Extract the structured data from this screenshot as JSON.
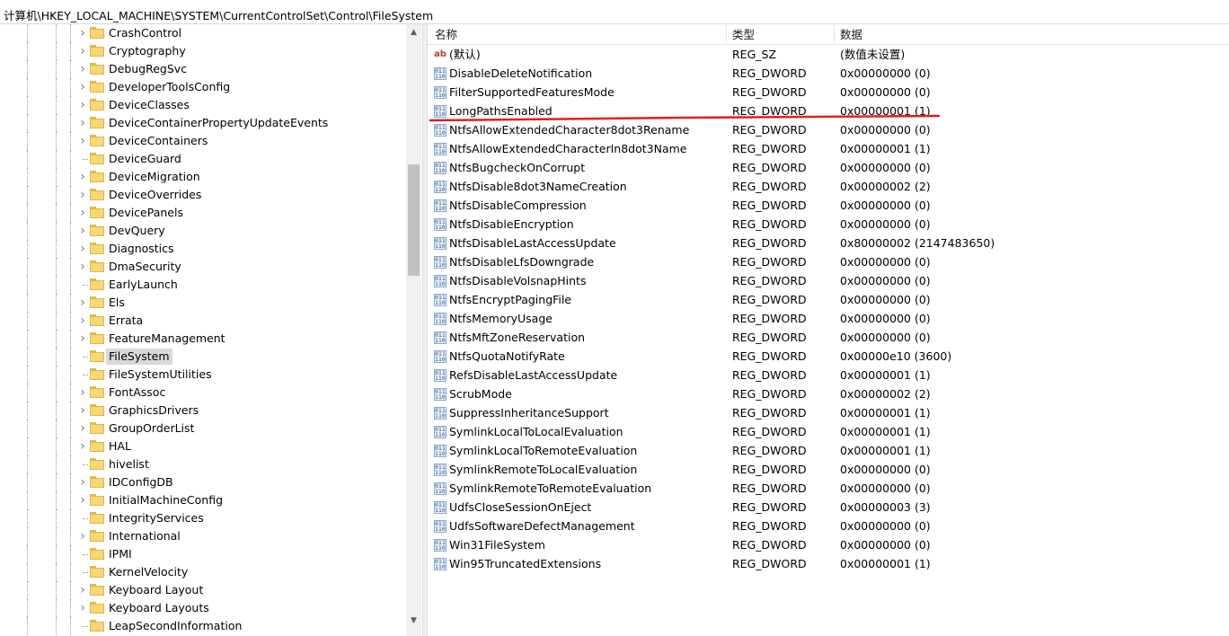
{
  "address_bar": {
    "path": "计算机\\HKEY_LOCAL_MACHINE\\SYSTEM\\CurrentControlSet\\Control\\FileSystem"
  },
  "tree": {
    "items": [
      {
        "label": "CrashControl",
        "expandable": true
      },
      {
        "label": "Cryptography",
        "expandable": true
      },
      {
        "label": "DebugRegSvc",
        "expandable": true
      },
      {
        "label": "DeveloperToolsConfig",
        "expandable": true
      },
      {
        "label": "DeviceClasses",
        "expandable": true
      },
      {
        "label": "DeviceContainerPropertyUpdateEvents",
        "expandable": true
      },
      {
        "label": "DeviceContainers",
        "expandable": true
      },
      {
        "label": "DeviceGuard",
        "expandable": false
      },
      {
        "label": "DeviceMigration",
        "expandable": true
      },
      {
        "label": "DeviceOverrides",
        "expandable": true
      },
      {
        "label": "DevicePanels",
        "expandable": true
      },
      {
        "label": "DevQuery",
        "expandable": true
      },
      {
        "label": "Diagnostics",
        "expandable": true
      },
      {
        "label": "DmaSecurity",
        "expandable": true
      },
      {
        "label": "EarlyLaunch",
        "expandable": false
      },
      {
        "label": "Els",
        "expandable": true
      },
      {
        "label": "Errata",
        "expandable": true
      },
      {
        "label": "FeatureManagement",
        "expandable": true
      },
      {
        "label": "FileSystem",
        "expandable": false,
        "selected": true
      },
      {
        "label": "FileSystemUtilities",
        "expandable": false
      },
      {
        "label": "FontAssoc",
        "expandable": true
      },
      {
        "label": "GraphicsDrivers",
        "expandable": true
      },
      {
        "label": "GroupOrderList",
        "expandable": true
      },
      {
        "label": "HAL",
        "expandable": true
      },
      {
        "label": "hivelist",
        "expandable": false
      },
      {
        "label": "IDConfigDB",
        "expandable": true
      },
      {
        "label": "InitialMachineConfig",
        "expandable": true
      },
      {
        "label": "IntegrityServices",
        "expandable": false
      },
      {
        "label": "International",
        "expandable": true
      },
      {
        "label": "IPMI",
        "expandable": false
      },
      {
        "label": "KernelVelocity",
        "expandable": false
      },
      {
        "label": "Keyboard Layout",
        "expandable": true
      },
      {
        "label": "Keyboard Layouts",
        "expandable": true
      },
      {
        "label": "LeapSecondInformation",
        "expandable": false
      }
    ]
  },
  "values_list": {
    "headers": {
      "name": "名称",
      "type": "类型",
      "data": "数据"
    },
    "rows": [
      {
        "icon": "ab",
        "name": "(默认)",
        "type": "REG_SZ",
        "data": "(数值未设置)"
      },
      {
        "icon": "dword",
        "name": "DisableDeleteNotification",
        "type": "REG_DWORD",
        "data": "0x00000000 (0)"
      },
      {
        "icon": "dword",
        "name": "FilterSupportedFeaturesMode",
        "type": "REG_DWORD",
        "data": "0x00000000 (0)"
      },
      {
        "icon": "dword",
        "name": "LongPathsEnabled",
        "type": "REG_DWORD",
        "data": "0x00000001 (1)"
      },
      {
        "icon": "dword",
        "name": "NtfsAllowExtendedCharacter8dot3Rename",
        "type": "REG_DWORD",
        "data": "0x00000000 (0)"
      },
      {
        "icon": "dword",
        "name": "NtfsAllowExtendedCharacterIn8dot3Name",
        "type": "REG_DWORD",
        "data": "0x00000001 (1)"
      },
      {
        "icon": "dword",
        "name": "NtfsBugcheckOnCorrupt",
        "type": "REG_DWORD",
        "data": "0x00000000 (0)"
      },
      {
        "icon": "dword",
        "name": "NtfsDisable8dot3NameCreation",
        "type": "REG_DWORD",
        "data": "0x00000002 (2)"
      },
      {
        "icon": "dword",
        "name": "NtfsDisableCompression",
        "type": "REG_DWORD",
        "data": "0x00000000 (0)"
      },
      {
        "icon": "dword",
        "name": "NtfsDisableEncryption",
        "type": "REG_DWORD",
        "data": "0x00000000 (0)"
      },
      {
        "icon": "dword",
        "name": "NtfsDisableLastAccessUpdate",
        "type": "REG_DWORD",
        "data": "0x80000002 (2147483650)"
      },
      {
        "icon": "dword",
        "name": "NtfsDisableLfsDowngrade",
        "type": "REG_DWORD",
        "data": "0x00000000 (0)"
      },
      {
        "icon": "dword",
        "name": "NtfsDisableVolsnapHints",
        "type": "REG_DWORD",
        "data": "0x00000000 (0)"
      },
      {
        "icon": "dword",
        "name": "NtfsEncryptPagingFile",
        "type": "REG_DWORD",
        "data": "0x00000000 (0)"
      },
      {
        "icon": "dword",
        "name": "NtfsMemoryUsage",
        "type": "REG_DWORD",
        "data": "0x00000000 (0)"
      },
      {
        "icon": "dword",
        "name": "NtfsMftZoneReservation",
        "type": "REG_DWORD",
        "data": "0x00000000 (0)"
      },
      {
        "icon": "dword",
        "name": "NtfsQuotaNotifyRate",
        "type": "REG_DWORD",
        "data": "0x00000e10 (3600)"
      },
      {
        "icon": "dword",
        "name": "RefsDisableLastAccessUpdate",
        "type": "REG_DWORD",
        "data": "0x00000001 (1)"
      },
      {
        "icon": "dword",
        "name": "ScrubMode",
        "type": "REG_DWORD",
        "data": "0x00000002 (2)"
      },
      {
        "icon": "dword",
        "name": "SuppressInheritanceSupport",
        "type": "REG_DWORD",
        "data": "0x00000001 (1)"
      },
      {
        "icon": "dword",
        "name": "SymlinkLocalToLocalEvaluation",
        "type": "REG_DWORD",
        "data": "0x00000001 (1)"
      },
      {
        "icon": "dword",
        "name": "SymlinkLocalToRemoteEvaluation",
        "type": "REG_DWORD",
        "data": "0x00000001 (1)"
      },
      {
        "icon": "dword",
        "name": "SymlinkRemoteToLocalEvaluation",
        "type": "REG_DWORD",
        "data": "0x00000000 (0)"
      },
      {
        "icon": "dword",
        "name": "SymlinkRemoteToRemoteEvaluation",
        "type": "REG_DWORD",
        "data": "0x00000000 (0)"
      },
      {
        "icon": "dword",
        "name": "UdfsCloseSessionOnEject",
        "type": "REG_DWORD",
        "data": "0x00000003 (3)"
      },
      {
        "icon": "dword",
        "name": "UdfsSoftwareDefectManagement",
        "type": "REG_DWORD",
        "data": "0x00000000 (0)"
      },
      {
        "icon": "dword",
        "name": "Win31FileSystem",
        "type": "REG_DWORD",
        "data": "0x00000000 (0)"
      },
      {
        "icon": "dword",
        "name": "Win95TruncatedExtensions",
        "type": "REG_DWORD",
        "data": "0x00000001 (1)"
      }
    ]
  },
  "annotation": {
    "color": "#e02020",
    "marks": "LongPathsEnabled"
  },
  "colors": {
    "selection": "#d9d9d9",
    "folder": "#f8d775",
    "scroll_thumb": "#c2c2c2"
  }
}
